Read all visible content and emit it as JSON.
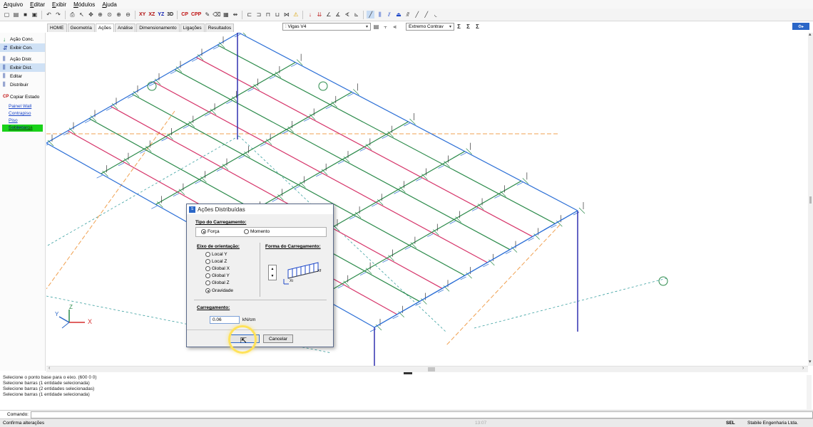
{
  "menu": {
    "items": [
      "Arquivo",
      "Editar",
      "Exibir",
      "Módulos",
      "Ajuda"
    ]
  },
  "toolbar": {
    "view_labels": [
      "XY",
      "XZ",
      "YZ",
      "3D"
    ],
    "cp_labels": [
      "CP",
      "CPP"
    ]
  },
  "tabs": [
    "HOME",
    "Geometria",
    "Ações",
    "Análise",
    "Dimensionamento",
    "Ligações",
    "Resultados"
  ],
  "active_tab": "Ações",
  "combos": {
    "view": "Vigas V4",
    "combination": "Extremo Contrav"
  },
  "sidebar": {
    "buttons": [
      {
        "label": "Ação Conc.",
        "icon": "↓",
        "selected": false
      },
      {
        "label": "Exibir Con.",
        "icon": "⇵",
        "selected": true
      },
      {
        "label": "Ação Distr.",
        "icon": "⫼",
        "selected": false
      },
      {
        "label": "Exibir Dist.",
        "icon": "⫼",
        "selected": true
      },
      {
        "label": "Editar",
        "icon": "⫼",
        "selected": false
      },
      {
        "label": "Distribuir",
        "icon": "⫼",
        "selected": false
      },
      {
        "label": "Copiar Estado",
        "icon": "CP",
        "selected": false
      }
    ],
    "links": [
      "Painel Wall",
      "Contrapiso",
      "Piso Cerâmico",
      "Sobrecarga"
    ]
  },
  "axis": {
    "x": "X",
    "y": "Y",
    "z": "Z"
  },
  "dialog": {
    "title": "Ações Distribuídas",
    "load_type_label": "Tipo do Carregamento:",
    "load_type_options": [
      "Força",
      "Momento"
    ],
    "load_type_selected": 0,
    "orientation_label": "Eixo de orientação:",
    "orientation_options": [
      "Local Y",
      "Local Z",
      "Global X",
      "Global Y",
      "Global Z",
      "Gravidade"
    ],
    "orientation_selected": 5,
    "shape_label": "Forma do Carregamento:",
    "shape_axis_x": "Xf",
    "shape_axis_xi": "Xi",
    "load_label": "Carregamento:",
    "load_value": "0.06",
    "load_unit": "kN/cm",
    "ok_label": "OK",
    "cancel_label": "Cancelar"
  },
  "console": {
    "lines": [
      "Selecione o ponto base para o eixo. (600 0 0)",
      "Selecione barras (1 entidade selecionada)",
      "Selecione barras (2 entidades selecionadas)",
      "Selecione barras (1 entidade selecionada)"
    ],
    "command_label": "Comando:"
  },
  "status": {
    "left": "Confirma alterações",
    "timestamp": "13:07",
    "mode": "SEL",
    "company": "Stabile Engenharia Ltda."
  },
  "colors": {
    "beam_blue": "#2c6fd6",
    "beam_red": "#d6356a",
    "beam_green": "#2b8a4a",
    "column_blue": "#3030b0",
    "guide_orange": "#f0a050",
    "guide_teal": "#3aa0a0"
  }
}
